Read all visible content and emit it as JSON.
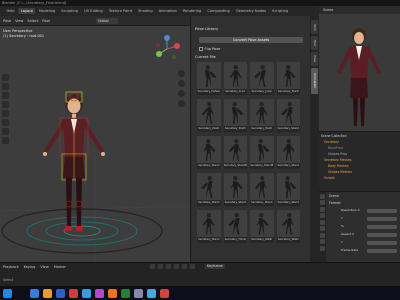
{
  "window": {
    "title": "Blender [C:\\...\\Secretary_Final.blend]"
  },
  "menubar": {
    "tabs": [
      {
        "label": "Help",
        "active": false
      },
      {
        "label": "Layout",
        "active": true
      },
      {
        "label": "Modeling",
        "active": false
      },
      {
        "label": "Sculpting",
        "active": false
      },
      {
        "label": "UV Editing",
        "active": false
      },
      {
        "label": "Texture Paint",
        "active": false
      },
      {
        "label": "Shading",
        "active": false
      },
      {
        "label": "Animation",
        "active": false
      },
      {
        "label": "Rendering",
        "active": false
      },
      {
        "label": "Compositing",
        "active": false
      },
      {
        "label": "Geometry Nodes",
        "active": false
      },
      {
        "label": "Scripting",
        "active": false
      }
    ]
  },
  "viewport": {
    "header_items": [
      "Pose",
      "View",
      "Select",
      "Pose"
    ],
    "transform_dropdown": "Global",
    "overlay_line1": "User Perspective",
    "overlay_line2": "(1) Secretary : root.001"
  },
  "pose_library": {
    "header": "Pose Library",
    "convert_button": "Convert Pose Assets",
    "flip_label": "Flip Pose",
    "current_file": "Current File",
    "poses": [
      "Secretary_Defaul",
      "Secretary_is Air",
      "Secretary_Jump",
      "Secretary_Positi",
      "Secretary_Positi",
      "Secretary_Positi",
      "Secretary_Positi",
      "Secretary_Stand",
      "Secretary_Stand",
      "Secretary_StandB",
      "Secretary_StandE",
      "Secretary_Stand",
      "Secretary_Stand",
      "Secretary_Stand",
      "Secretary_Stand",
      "Secretary_Stand",
      "Secretary_Stand",
      "Secretary_Thinki",
      "Secretary_Walki",
      "Secretary_Walki"
    ]
  },
  "side_tabs": [
    "Item",
    "Tool",
    "View",
    "Animation"
  ],
  "right_panel": {
    "header": "Scene",
    "outliner": [
      "Scene Collection",
      "Secretary",
      "BoneProp",
      "Shapes Prop",
      "Secretary Meshes",
      "Body Meshes",
      "Shapes Meshes",
      "Scripts"
    ],
    "properties": {
      "title": "Scene",
      "section": "Format",
      "fields": [
        "Resolution X",
        "Y",
        "%",
        "Aspect X",
        "Y",
        "Frame Rate"
      ]
    }
  },
  "timeline": {
    "menu": [
      "Playback",
      "Keying",
      "View",
      "Marker"
    ],
    "keying_set": "Keyframe",
    "status": "Select"
  },
  "taskbar": {
    "icon_colors": [
      "#3a7bd5",
      "#e0a030",
      "#2f5fc4",
      "#d33a3a",
      "#35a0e0",
      "#b04bd0",
      "#e87722",
      "#2b7a3b",
      "#8888aa",
      "#44aadd",
      "#cc4444"
    ]
  }
}
